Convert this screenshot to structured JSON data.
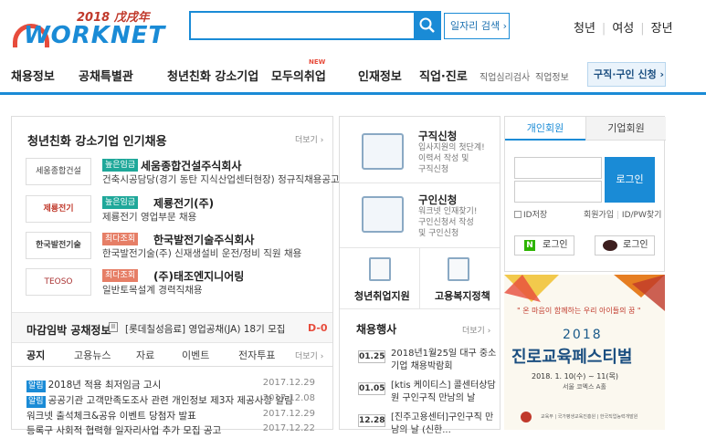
{
  "header": {
    "logo_year": "2018 戊戌年",
    "logo_text": "WORKNET",
    "search_placeholder": "",
    "job_search_label": "일자리 검색 ›",
    "top_links": [
      "청년",
      "여성",
      "장년"
    ]
  },
  "nav": {
    "items": [
      "채용정보",
      "공채특별관",
      "청년친화 강소기업",
      "모두의취업",
      "인재정보",
      "직업·진로"
    ],
    "new_badge": "NEW",
    "small_links": [
      "직업심리검사",
      "직업정보"
    ],
    "apply_label": "구직·구인 신청 ›"
  },
  "youth": {
    "title": "청년친화 강소기업 인기채용",
    "more": "더보기 ›",
    "companies": [
      {
        "logo": "세움종합건설",
        "badge": "높은임금",
        "badge_color": "green",
        "name": "세움종합건설주식회사",
        "desc": "건축시공담당(경기 동탄 지식산업센터현장) 정규직채용공고"
      },
      {
        "logo": "제룡전기",
        "badge": "높은임금",
        "badge_color": "green",
        "name": "제룡전기(주)",
        "desc": "제룡전기 영업부문 채용"
      },
      {
        "logo": "한국발전기술",
        "badge": "최다조회",
        "badge_color": "red",
        "name": "한국발전기술주식회사",
        "desc": "한국발전기술(주) 신재생설비 운전/정비 직원 채용"
      },
      {
        "logo": "TEOSO",
        "badge": "최다조회",
        "badge_color": "red",
        "name": "(주)태조엔지니어링",
        "desc": "일반토목설계 경력직채용"
      }
    ]
  },
  "deadline": {
    "title": "마감임박 공채정보",
    "pause": "II",
    "text": "[롯데칠성음료] 영업공채(JA) 18기 모집",
    "dday": "D-0"
  },
  "notice_tabs": {
    "tabs": [
      "공지",
      "고용뉴스",
      "자료",
      "이벤트",
      "전자투표"
    ],
    "more": "더보기 ›",
    "items": [
      {
        "tag": "알림",
        "text": "2018년 적용 최저임금 고시",
        "date": "2017.12.29"
      },
      {
        "tag": "알림",
        "text": "공공기관 고객만족도조사 관련 개인정보 제3자 제공사항 알림",
        "date": "2017.12.08"
      },
      {
        "tag": "",
        "text": "워크넷 출석체크&공유 이벤트 당첨자 발표",
        "date": "2017.12.29"
      },
      {
        "tag": "",
        "text": "등록구 사회적 협력형 일자리사업 추가 모집 공고",
        "date": "2017.12.22"
      }
    ]
  },
  "services": {
    "job_seek": {
      "title": "구직신청",
      "desc": [
        "입사지원의 첫단계!",
        "이력서 작성 및",
        "구직신청"
      ]
    },
    "hire": {
      "title": "구인신청",
      "desc": [
        "워크넷 인재찾기!",
        "구인신청서 작성",
        "및 구인신청"
      ]
    },
    "youth_support": "청년취업지원",
    "welfare": "고용복지정책"
  },
  "events": {
    "title": "채용행사",
    "more": "더보기 ›",
    "items": [
      {
        "date": "01.25",
        "text": "2018년1월25일 대구 중소기업 채용박람회"
      },
      {
        "date": "01.05",
        "text": "[ktis 케이티스] 콜센터상담원 구인구직 만남의 날"
      },
      {
        "date": "12.28",
        "text": "[진주고용센터]구인구직 만남의 날 (신한..."
      }
    ]
  },
  "login": {
    "tab_personal": "개인회원",
    "tab_company": "기업회원",
    "login_label": "로그인",
    "save_id": "ID저장",
    "join": "회원가입",
    "find": "ID/PW찾기",
    "naver_login": "로그인",
    "kakao_login": "로그인"
  },
  "banner": {
    "sub": "\" 온 마음이 함께하는 우리 아이들의 꿈 \"",
    "year": "2018",
    "title": "진로교육페스티벌",
    "date": "2018. 1. 10(수) ~ 11(목)",
    "place": "서울 코엑스 A홀",
    "footer": "교육부 | 국가평생교육진흥원 | 한국직업능력개발원"
  }
}
